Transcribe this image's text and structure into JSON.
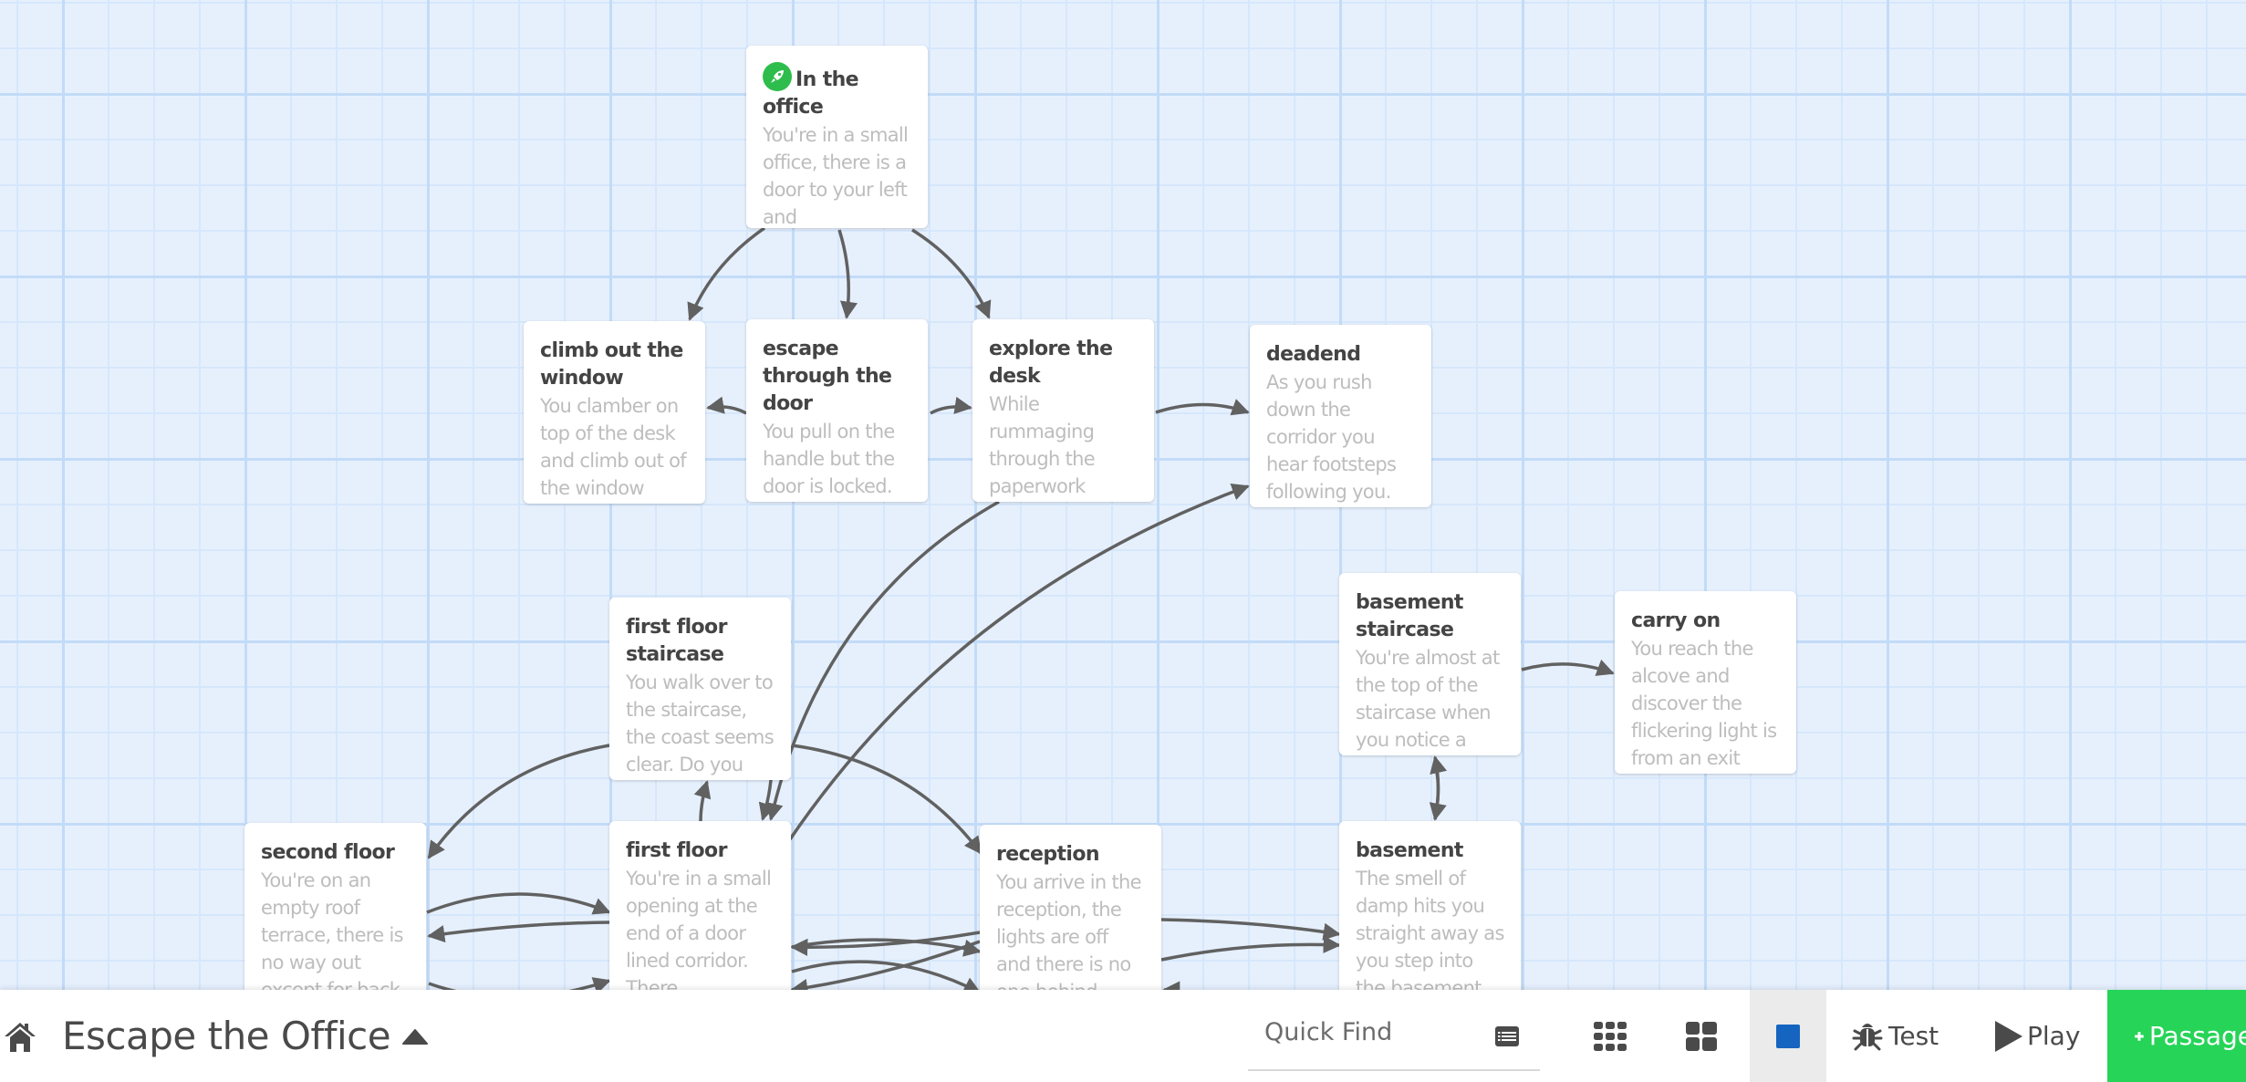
{
  "story": {
    "title": "Escape the Office"
  },
  "passages": [
    {
      "id": "office",
      "title": "In the office",
      "excerpt": "You're in a small office, there is a door to your left and",
      "start": true
    },
    {
      "id": "climb",
      "title": "climb out the window",
      "excerpt": "You clamber on top of the desk and climb out of the window"
    },
    {
      "id": "escape",
      "title": "escape through the door",
      "excerpt": "You pull on the handle but the door is locked."
    },
    {
      "id": "explore",
      "title": "explore the desk",
      "excerpt": "While rummaging through the paperwork"
    },
    {
      "id": "deadend",
      "title": "deadend",
      "excerpt": "As you rush down the corridor you hear footsteps following you."
    },
    {
      "id": "ffstair",
      "title": "first floor staircase",
      "excerpt": "You walk over to the staircase, the coast seems clear. Do you"
    },
    {
      "id": "bstair",
      "title": "basement staircase",
      "excerpt": "You're almost at the top of the staircase when you notice a"
    },
    {
      "id": "carry",
      "title": "carry on",
      "excerpt": "You reach the alcove and discover the flickering light is from an exit"
    },
    {
      "id": "second",
      "title": "second floor",
      "excerpt": "You're on an empty roof terrace, there is no way out except for back"
    },
    {
      "id": "first",
      "title": "first floor",
      "excerpt": "You're in a small opening at the end of a door lined corridor. There"
    },
    {
      "id": "reception",
      "title": "reception",
      "excerpt": "You arrive in the reception, the lights are off and there is no one behind"
    },
    {
      "id": "basement",
      "title": "basement",
      "excerpt": "The smell of damp hits you straight away as you step into the basement"
    }
  ],
  "links": [
    {
      "from": "office",
      "to": "climb"
    },
    {
      "from": "office",
      "to": "escape"
    },
    {
      "from": "office",
      "to": "explore"
    },
    {
      "from": "escape",
      "to": "climb"
    },
    {
      "from": "escape",
      "to": "explore"
    },
    {
      "from": "explore",
      "to": "deadend"
    },
    {
      "from": "explore",
      "to": "first"
    },
    {
      "from": "first",
      "to": "deadend"
    },
    {
      "from": "ffstair",
      "to": "second"
    },
    {
      "from": "ffstair",
      "to": "reception"
    },
    {
      "from": "ffstair",
      "to": "first"
    },
    {
      "from": "first",
      "to": "ffstair"
    },
    {
      "from": "second",
      "to": "first"
    },
    {
      "from": "first",
      "to": "second"
    },
    {
      "from": "first",
      "to": "reception"
    },
    {
      "from": "reception",
      "to": "first"
    },
    {
      "from": "reception",
      "to": "basement"
    },
    {
      "from": "bstair",
      "to": "carry"
    },
    {
      "from": "bstair",
      "to": "basement"
    },
    {
      "from": "basement",
      "to": "bstair"
    }
  ],
  "toolbar": {
    "home_icon": "home-icon",
    "title_caret_icon": "caret-up-icon",
    "quick_find_placeholder": "Quick Find",
    "list_icon": "passage-list-icon",
    "grid_small_icon": "grid-small-icon",
    "grid_large_icon": "grid-large-icon",
    "single_icon": "square-icon",
    "test_label": "Test",
    "play_label": "Play",
    "passage_label": "Passage"
  },
  "colors": {
    "canvas_bg": "#e6f0fd",
    "link_stroke": "#616161",
    "start_badge": "#2ebd4c",
    "add_passage": "#26d458",
    "selected_zoom_square": "#1565c0"
  }
}
